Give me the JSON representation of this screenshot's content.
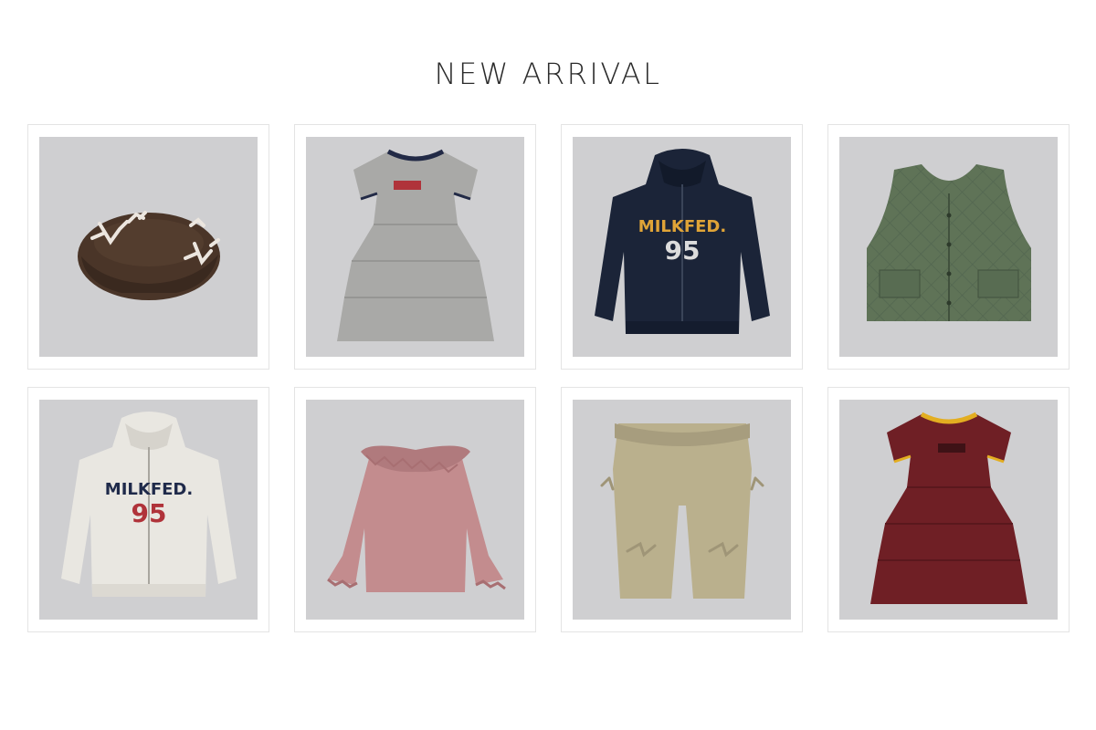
{
  "section": {
    "title": "NEW ARRIVAL"
  },
  "products": [
    {
      "name": "brown-beret-with-bows",
      "colors": {
        "main": "#4a3528",
        "accent": "#ece6df"
      }
    },
    {
      "name": "grey-tiered-dress",
      "colors": {
        "main": "#a9a9a7",
        "accent": "#222a46"
      }
    },
    {
      "name": "navy-zip-hoodie",
      "colors": {
        "main": "#1b2438",
        "accent": "#e0a437"
      }
    },
    {
      "name": "green-quilted-vest",
      "colors": {
        "main": "#5f7357",
        "accent": "#41513d"
      }
    },
    {
      "name": "oatmeal-zip-hoodie",
      "colors": {
        "main": "#e9e7e1",
        "accent": "#1f2a4a"
      }
    },
    {
      "name": "pink-ruffle-collar-top",
      "colors": {
        "main": "#c38c8e",
        "accent": "#a86f72"
      }
    },
    {
      "name": "khaki-bow-cargo-pants",
      "colors": {
        "main": "#bab08d",
        "accent": "#9f9577"
      }
    },
    {
      "name": "burgundy-tiered-dress",
      "colors": {
        "main": "#6f1f25",
        "accent": "#e3ae21"
      }
    }
  ]
}
